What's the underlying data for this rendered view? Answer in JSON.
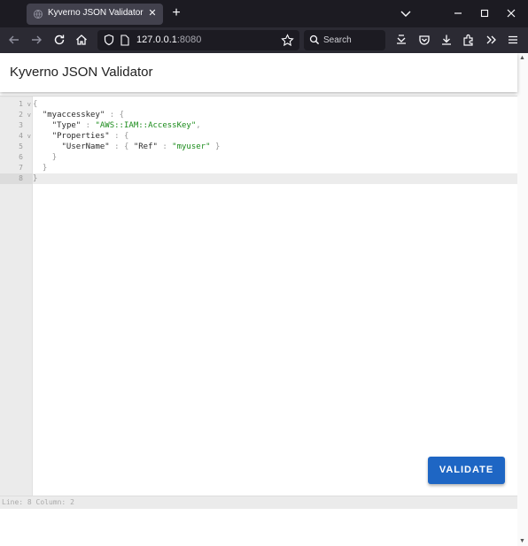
{
  "browser": {
    "tab_title": "Kyverno JSON Validator",
    "url_host": "127.0.0.1",
    "url_port": ":8080",
    "search_label": "Search"
  },
  "app": {
    "title": "Kyverno JSON Validator",
    "validate_label": "VALIDATE"
  },
  "editor": {
    "lines": [
      {
        "num": "1",
        "fold": "v",
        "text": "{"
      },
      {
        "num": "2",
        "fold": "v",
        "text": "  \"myaccesskey\" : {"
      },
      {
        "num": "3",
        "fold": "",
        "text": "    \"Type\" : \"AWS::IAM::AccessKey\","
      },
      {
        "num": "4",
        "fold": "v",
        "text": "    \"Properties\" : {"
      },
      {
        "num": "5",
        "fold": "",
        "text": "      \"UserName\" : { \"Ref\" : \"myuser\" }"
      },
      {
        "num": "6",
        "fold": "",
        "text": "    }"
      },
      {
        "num": "7",
        "fold": "",
        "text": "  }"
      },
      {
        "num": "8",
        "fold": "",
        "text": "}"
      }
    ],
    "active_line": 8,
    "status": "Line: 8  Column: 2"
  },
  "colors": {
    "string": "#1a8b1a",
    "button": "#1e66c4"
  }
}
